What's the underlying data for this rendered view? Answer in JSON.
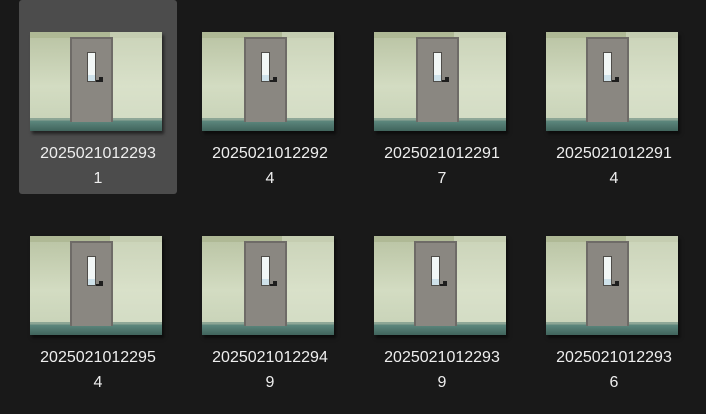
{
  "explorer": {
    "view": "large-icons",
    "selected_index": 0,
    "thumbnail_icon": "photo-thumbnail-icon",
    "items": [
      {
        "name_line1": "2025021012293",
        "name_line2": "1"
      },
      {
        "name_line1": "2025021012292",
        "name_line2": "4"
      },
      {
        "name_line1": "2025021012291",
        "name_line2": "7"
      },
      {
        "name_line1": "2025021012291",
        "name_line2": "4"
      },
      {
        "name_line1": "2025021012295",
        "name_line2": "4"
      },
      {
        "name_line1": "2025021012294",
        "name_line2": "9"
      },
      {
        "name_line1": "2025021012293",
        "name_line2": "9"
      },
      {
        "name_line1": "2025021012293",
        "name_line2": "6"
      }
    ]
  },
  "colors": {
    "background": "#191919",
    "selection": "#4c4c4c",
    "label_text": "#eeeeee"
  }
}
